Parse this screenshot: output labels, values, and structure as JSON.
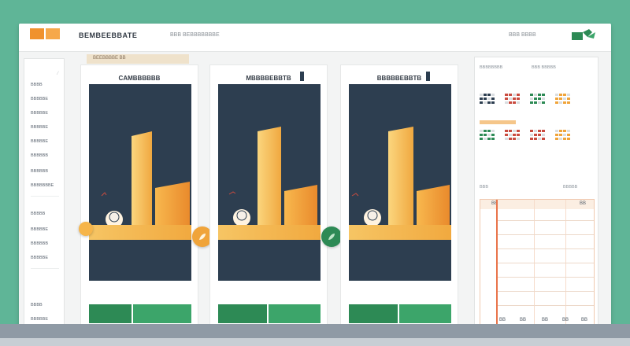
{
  "app": {
    "title": "BEMBEEBBATE",
    "menu_text": "BBB BEBBBBBBBE",
    "top_right_text": "BBB BBBB",
    "accent_color": "#f0922e",
    "brand_green": "#2d8a55"
  },
  "sidebar": {
    "items": [
      {
        "label": "BBBB"
      },
      {
        "label": "BBBBBE"
      },
      {
        "label": "BBBBBE"
      },
      {
        "label": "BBBBBE"
      },
      {
        "label": "BBBBBE"
      },
      {
        "label": "BBBBBB"
      },
      {
        "label": "BBBBBB"
      },
      {
        "label": "BBBBBBBE"
      },
      {
        "label": "BBBBB"
      },
      {
        "label": "BBBBBE"
      },
      {
        "label": "BBBBBB"
      },
      {
        "label": "BBBBBE"
      },
      {
        "label": "BBBB"
      },
      {
        "label": "BBBBBE"
      }
    ]
  },
  "tabstrip": {
    "label": "BEEBBBBE BB"
  },
  "panels": [
    {
      "title": "CAMBBBBBB",
      "level": 0.95,
      "action_icon": "egg-icon"
    },
    {
      "title": "MBBBBEBBTB",
      "level": 0.95,
      "action_icon": "leaf-icon"
    },
    {
      "title": "BBBBBEBBTB",
      "level": 0.95,
      "action_icon": ""
    }
  ],
  "right_panel": {
    "header_left": "BBBBBBBB",
    "header_right": "BBB BBBBB",
    "mini_row1_colors": [
      "#2d3e50",
      "#c94b3f",
      "#2d8a55",
      "#f0a43a"
    ],
    "mini_row2_colors": [
      "#2d8a55",
      "#c94b3f",
      "#c94b3f",
      "#f0a43a"
    ],
    "table_caption_left": "BBB",
    "table_caption_right": "BBBBB",
    "table_header_left": "BB",
    "table_header_right": "BB",
    "table_footer": [
      "BB",
      "BB",
      "BB",
      "BB",
      "BB"
    ]
  }
}
